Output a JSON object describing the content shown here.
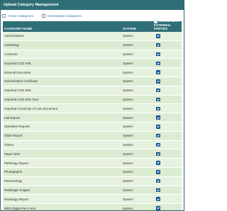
{
  "window": {
    "title": "Upload Category Management"
  },
  "filters": {
    "active_label": "Active Categories",
    "deactivated_label": "Deactivated Categories"
  },
  "table": {
    "headers": {
      "name": "CATEGORY NAME",
      "system": "SYSTEM",
      "share_line1": "SHARE WITH",
      "share_line2": "EXTERNAL PARTIES"
    },
    "rows": [
      {
        "name": "Authorizations",
        "system": "System",
        "share": true
      },
      {
        "name": "Cardiology",
        "system": "System",
        "share": true
      },
      {
        "name": "Consents",
        "system": "System",
        "share": true
      },
      {
        "name": "Exported CCD XML",
        "system": "System",
        "share": true
      },
      {
        "name": "External Document",
        "system": "System",
        "share": true
      },
      {
        "name": "Immunization Certificate",
        "system": "System",
        "share": true
      },
      {
        "name": "Imported CCD XML",
        "system": "System",
        "share": true
      },
      {
        "name": "Imported CCD XML OLD",
        "system": "System",
        "share": true
      },
      {
        "name": "Imported Continuity of Care Document",
        "system": "System",
        "share": true
      },
      {
        "name": "Lab Report",
        "system": "System",
        "share": true
      },
      {
        "name": "Operative Reports",
        "system": "System",
        "share": true
      },
      {
        "name": "Other Report",
        "system": "System",
        "share": true
      },
      {
        "name": "Others",
        "system": "System",
        "share": true
      },
      {
        "name": "Paper Note",
        "system": "System",
        "share": true
      },
      {
        "name": "Pathology Report",
        "system": "System",
        "share": true
      },
      {
        "name": "Photographs",
        "system": "System",
        "share": true
      },
      {
        "name": "Pulmonology",
        "system": "System",
        "share": true
      },
      {
        "name": "Radiologic Images",
        "system": "System",
        "share": true
      },
      {
        "name": "Radiology Report",
        "system": "System",
        "share": true
      },
      {
        "name": "WRS Digital Pen Form",
        "system": "System",
        "share": true
      }
    ]
  },
  "colors": {
    "header_bg": "#2f6e77",
    "row_odd": "#e6f2df",
    "row_even": "#dcecd3",
    "checkbox": "#1f5fa8",
    "link": "#2a7aa8"
  }
}
